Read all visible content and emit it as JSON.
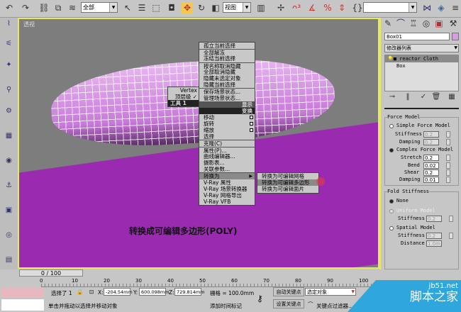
{
  "toolbar": {
    "selection_filter": "全部",
    "reference_coord": "视图",
    "named_selection": ""
  },
  "viewport": {
    "label": "透视",
    "caption": "转换成可编辑多边形(POLY)"
  },
  "quad_left": {
    "items": [
      "Vertex",
      "顶层级 ✓"
    ],
    "header": "工具 1"
  },
  "quad_main": {
    "display_items": [
      "孤立当前选择",
      "全部解冻",
      "冻结当前选择",
      "按名称取消隐藏",
      "全部取消隐藏",
      "隐藏未选定对象",
      "隐藏当前选择",
      "保存场景状态...",
      "管理场景状态..."
    ],
    "display_header": "显示",
    "transform_header": "变换",
    "transform_items": [
      "移动",
      "旋转",
      "缩放",
      "选择",
      "克隆(C)",
      "属性(P)...",
      "曲线编辑器...",
      "摄影表...",
      "关联参数...",
      "转换为"
    ],
    "vray_items": [
      "V-Ray 属性",
      "V-Ray 场景转换器",
      "V-Ray 网格导出",
      "V-Ray VFB"
    ]
  },
  "submenu": {
    "items": [
      "转换为可编辑网格",
      "转换为可编辑多边形",
      "转换为可编辑面片"
    ],
    "highlighted": "转换为可编辑多边形"
  },
  "command_panel": {
    "object_name": "Box01",
    "object_color": "#d99be6",
    "modifier_list": "修改器列表",
    "stack": [
      "reactor Cloth",
      "Box"
    ],
    "force_model": {
      "title": "Force Model",
      "simple": "Simple Force Model",
      "simple_stiffness_label": "Stiffness",
      "simple_stiffness": "0.2",
      "simple_damping_label": "Damping",
      "simple_damping": "0.2",
      "complex": "Complex Force Model",
      "stretch_label": "Stretch",
      "stretch": "0.2",
      "bend_label": "Bend",
      "bend": "0.02",
      "shear_label": "Shear",
      "shear": "0.2",
      "damping_label": "Damping",
      "damping": "0.01",
      "selected": "complex"
    },
    "fold_stiffness": {
      "title": "Fold Stiffness",
      "none": "None",
      "uniform": "Uniform Model",
      "uniform_stiffness_label": "Stiffness",
      "uniform_stiffness": "0.2",
      "spatial": "Spatial Model",
      "spatial_stiffness_label": "Stiffness",
      "spatial_stiffness": "0.2",
      "distance_label": "Distance",
      "distance": "1.0m",
      "selected": "none"
    }
  },
  "timeline": {
    "slider": "0 / 100",
    "ticks": [
      "0",
      "10",
      "20",
      "30",
      "40",
      "50",
      "60",
      "70",
      "80",
      "90",
      "100"
    ]
  },
  "status": {
    "selected": "选择了 1",
    "x_label": "X:",
    "x": "-204.54mm",
    "y_label": "Y:",
    "y": "600.098mm",
    "z_label": "Z:",
    "z": "729.814mm",
    "grid": "栅格 = 100.0mm",
    "auto_key": "自动关键点",
    "set_key": "设置关键点",
    "key_mode": "选定对象",
    "key_filters": "关键点过滤器...",
    "prompt": "单击并拖动以选择并移动对象",
    "add_time_tag": "添加时间标记"
  },
  "watermark": {
    "site": "jb51.net",
    "name": "脚本之家"
  },
  "colors": {
    "viewport_border": "#e8e860",
    "floor": "#9a2bb0",
    "highlight": "#8a8a8a"
  }
}
